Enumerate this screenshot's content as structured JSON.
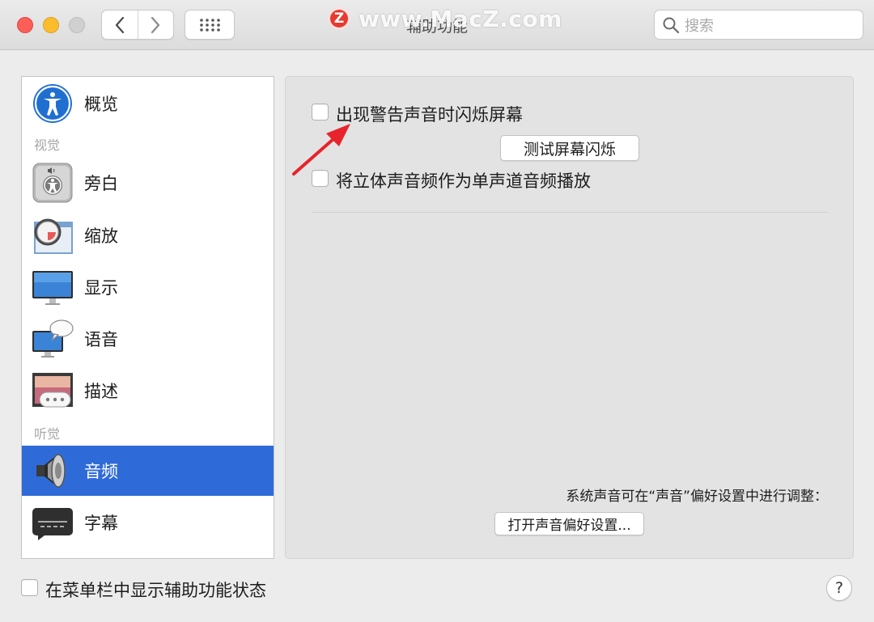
{
  "window": {
    "title": "辅助功能",
    "search_placeholder": "搜索",
    "watermark_text": "www.MacZ.com",
    "watermark_logo": "Z"
  },
  "sidebar": {
    "items": [
      {
        "label": "概览",
        "icon": "accessibility-overview-icon"
      },
      {
        "label": "旁白",
        "icon": "voiceover-icon"
      },
      {
        "label": "缩放",
        "icon": "zoom-icon"
      },
      {
        "label": "显示",
        "icon": "display-icon"
      },
      {
        "label": "语音",
        "icon": "speech-icon"
      },
      {
        "label": "描述",
        "icon": "descriptions-icon"
      },
      {
        "label": "音频",
        "icon": "audio-speaker-icon",
        "selected": true
      },
      {
        "label": "字幕",
        "icon": "captions-icon"
      }
    ],
    "sections": {
      "vision": "视觉",
      "hearing": "听觉"
    }
  },
  "audio": {
    "flash_screen_label": "出现警告声音时闪烁屏幕",
    "flash_screen_checked": false,
    "test_flash_button": "测试屏幕闪烁",
    "mono_audio_label": "将立体声音频作为单声道音频播放",
    "mono_audio_checked": false,
    "note": "系统声音可在“声音”偏好设置中进行调整：",
    "open_sound_prefs_button": "打开声音偏好设置..."
  },
  "bottom": {
    "menu_bar_label": "在菜单栏中显示辅助功能状态",
    "menu_bar_checked": false,
    "help_label": "?"
  },
  "colors": {
    "selection": "#2f6bd8",
    "annotation_arrow": "#e8232b",
    "close": "#fc5f57",
    "minimize": "#fdbc2e"
  }
}
